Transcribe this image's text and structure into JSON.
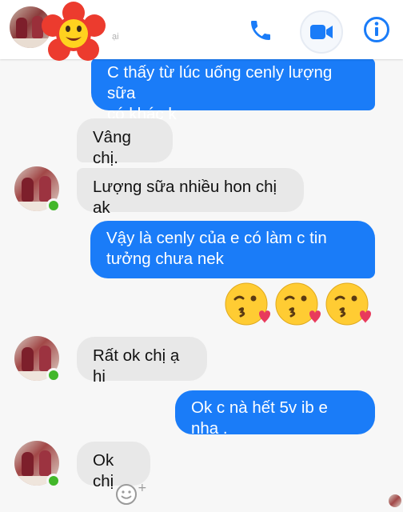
{
  "header": {
    "subtitle": "ại",
    "icons": {
      "call": "phone-icon",
      "video": "video-camera-icon",
      "info": "info-icon",
      "sticker": "smiling-flower-sticker"
    }
  },
  "messages": [
    {
      "id": "m1",
      "direction": "sent",
      "text": "C thấy từ lúc uống cenly lượng sữa\ncó khác k"
    },
    {
      "id": "m2",
      "direction": "received",
      "text": "Vâng chị."
    },
    {
      "id": "m3",
      "direction": "received",
      "text": "Lượng sữa nhiều hon chị ak"
    },
    {
      "id": "m4",
      "direction": "sent",
      "text": "Vậy là cenly của e có làm c tin\ntưởng chưa nek"
    },
    {
      "id": "m5",
      "direction": "sent",
      "emoji": [
        "face-blowing-kiss-icon",
        "face-blowing-kiss-icon",
        "face-blowing-kiss-icon"
      ]
    },
    {
      "id": "m6",
      "direction": "received",
      "text": "Rất ok chị ạ hi"
    },
    {
      "id": "m7",
      "direction": "sent",
      "text": "Ok c nà hết 5v ib e nha ."
    },
    {
      "id": "m8",
      "direction": "received",
      "text": "Ok chị"
    }
  ],
  "reaction_button": {
    "icon": "add-reaction-icon",
    "symbol": "+"
  },
  "colors": {
    "sent_bubble": "#1a7cf8",
    "received_bubble": "#e8e8e8",
    "accent": "#1a7cf8",
    "online": "#42b72a",
    "background": "#f7f7f7"
  }
}
